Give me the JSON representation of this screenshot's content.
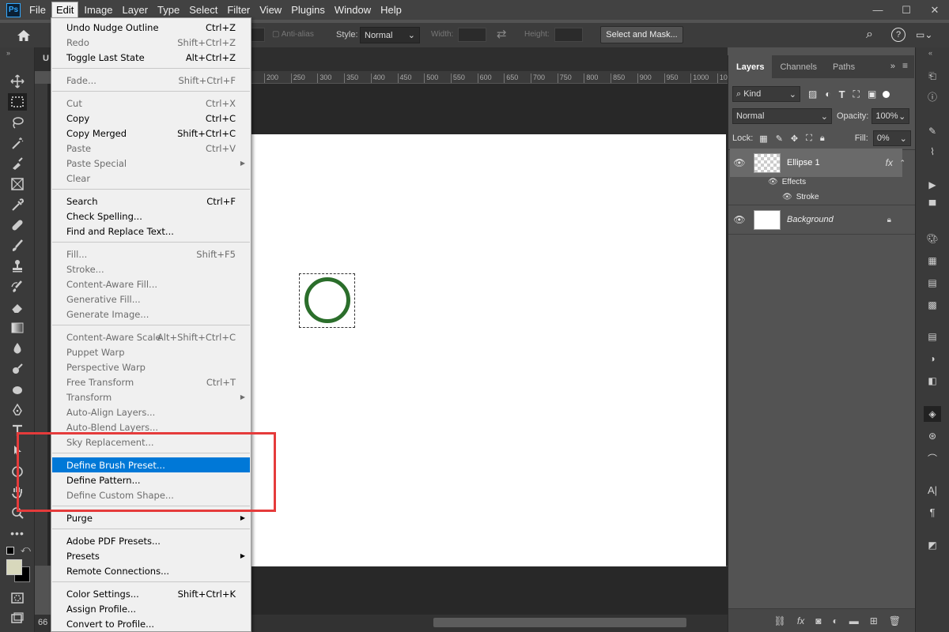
{
  "app": {
    "logo": "Ps"
  },
  "menubar": [
    {
      "label": "File"
    },
    {
      "label": "Edit",
      "active": true
    },
    {
      "label": "Image"
    },
    {
      "label": "Layer"
    },
    {
      "label": "Type"
    },
    {
      "label": "Select"
    },
    {
      "label": "Filter"
    },
    {
      "label": "View"
    },
    {
      "label": "Plugins"
    },
    {
      "label": "Window"
    },
    {
      "label": "Help"
    }
  ],
  "window_controls": {
    "minimize": "—",
    "maximize": "☐",
    "close": "✕"
  },
  "options_bar": {
    "antialias_label": "Anti-alias",
    "style_label": "Style:",
    "style_value": "Normal",
    "width_label": "Width:",
    "height_label": "Height:",
    "select_mask_label": "Select and Mask..."
  },
  "ruler": [
    "200",
    "250",
    "300",
    "350",
    "400",
    "450",
    "500",
    "550",
    "600",
    "650",
    "700",
    "750",
    "800",
    "850",
    "900",
    "950",
    "1000",
    "105"
  ],
  "status": {
    "zoom": "66"
  },
  "tab_title_fragment": "U",
  "edit_menu": [
    {
      "label": "Undo Nudge Outline",
      "shortcut": "Ctrl+Z",
      "disabled": false
    },
    {
      "label": "Redo",
      "shortcut": "Shift+Ctrl+Z",
      "disabled": true
    },
    {
      "label": "Toggle Last State",
      "shortcut": "Alt+Ctrl+Z",
      "disabled": false
    },
    {
      "separator": true
    },
    {
      "label": "Fade...",
      "shortcut": "Shift+Ctrl+F",
      "disabled": true
    },
    {
      "separator": true
    },
    {
      "label": "Cut",
      "shortcut": "Ctrl+X",
      "disabled": true
    },
    {
      "label": "Copy",
      "shortcut": "Ctrl+C",
      "disabled": false
    },
    {
      "label": "Copy Merged",
      "shortcut": "Shift+Ctrl+C",
      "disabled": false
    },
    {
      "label": "Paste",
      "shortcut": "Ctrl+V",
      "disabled": true
    },
    {
      "label": "Paste Special",
      "shortcut": "",
      "disabled": true,
      "submenu": true
    },
    {
      "label": "Clear",
      "shortcut": "",
      "disabled": true
    },
    {
      "separator": true
    },
    {
      "label": "Search",
      "shortcut": "Ctrl+F",
      "disabled": false
    },
    {
      "label": "Check Spelling...",
      "shortcut": "",
      "disabled": false
    },
    {
      "label": "Find and Replace Text...",
      "shortcut": "",
      "disabled": false
    },
    {
      "separator": true
    },
    {
      "label": "Fill...",
      "shortcut": "Shift+F5",
      "disabled": true
    },
    {
      "label": "Stroke...",
      "shortcut": "",
      "disabled": true
    },
    {
      "label": "Content-Aware Fill...",
      "shortcut": "",
      "disabled": true
    },
    {
      "label": "Generative Fill...",
      "shortcut": "",
      "disabled": true
    },
    {
      "label": "Generate Image...",
      "shortcut": "",
      "disabled": true
    },
    {
      "separator": true
    },
    {
      "label": "Content-Aware Scale",
      "shortcut": "Alt+Shift+Ctrl+C",
      "disabled": true
    },
    {
      "label": "Puppet Warp",
      "shortcut": "",
      "disabled": true
    },
    {
      "label": "Perspective Warp",
      "shortcut": "",
      "disabled": true
    },
    {
      "label": "Free Transform",
      "shortcut": "Ctrl+T",
      "disabled": true
    },
    {
      "label": "Transform",
      "shortcut": "",
      "disabled": true,
      "submenu": true
    },
    {
      "label": "Auto-Align Layers...",
      "shortcut": "",
      "disabled": true
    },
    {
      "label": "Auto-Blend Layers...",
      "shortcut": "",
      "disabled": true
    },
    {
      "label": "Sky Replacement...",
      "shortcut": "",
      "disabled": true
    },
    {
      "separator": true
    },
    {
      "label": "Define Brush Preset...",
      "shortcut": "",
      "disabled": false,
      "highlighted": true
    },
    {
      "label": "Define Pattern...",
      "shortcut": "",
      "disabled": false
    },
    {
      "label": "Define Custom Shape...",
      "shortcut": "",
      "disabled": true
    },
    {
      "separator": true
    },
    {
      "label": "Purge",
      "shortcut": "",
      "disabled": false,
      "submenu": true
    },
    {
      "separator": true
    },
    {
      "label": "Adobe PDF Presets...",
      "shortcut": "",
      "disabled": false
    },
    {
      "label": "Presets",
      "shortcut": "",
      "disabled": false,
      "submenu": true
    },
    {
      "label": "Remote Connections...",
      "shortcut": "",
      "disabled": false
    },
    {
      "separator": true
    },
    {
      "label": "Color Settings...",
      "shortcut": "Shift+Ctrl+K",
      "disabled": false
    },
    {
      "label": "Assign Profile...",
      "shortcut": "",
      "disabled": false
    },
    {
      "label": "Convert to Profile...",
      "shortcut": "",
      "disabled": false
    }
  ],
  "layers_panel": {
    "tabs": [
      {
        "label": "Layers",
        "active": true
      },
      {
        "label": "Channels"
      },
      {
        "label": "Paths"
      }
    ],
    "filter_kind": "Kind",
    "blend_mode": "Normal",
    "opacity_label": "Opacity:",
    "opacity_value": "100%",
    "lock_label": "Lock:",
    "fill_label": "Fill:",
    "fill_value": "0%",
    "layers": [
      {
        "name": "Ellipse 1",
        "fx": "fx",
        "selected": true
      },
      {
        "name": "Background",
        "italic": true,
        "locked": true
      }
    ],
    "effects_label": "Effects",
    "stroke_label": "Stroke"
  },
  "colors": {
    "menu_highlight": "#0078d7",
    "annotation_box": "#e53b3b",
    "ellipse_stroke": "#2b6e2b",
    "foreground_swatch": "#d8d8bc",
    "background_swatch": "#000000"
  }
}
